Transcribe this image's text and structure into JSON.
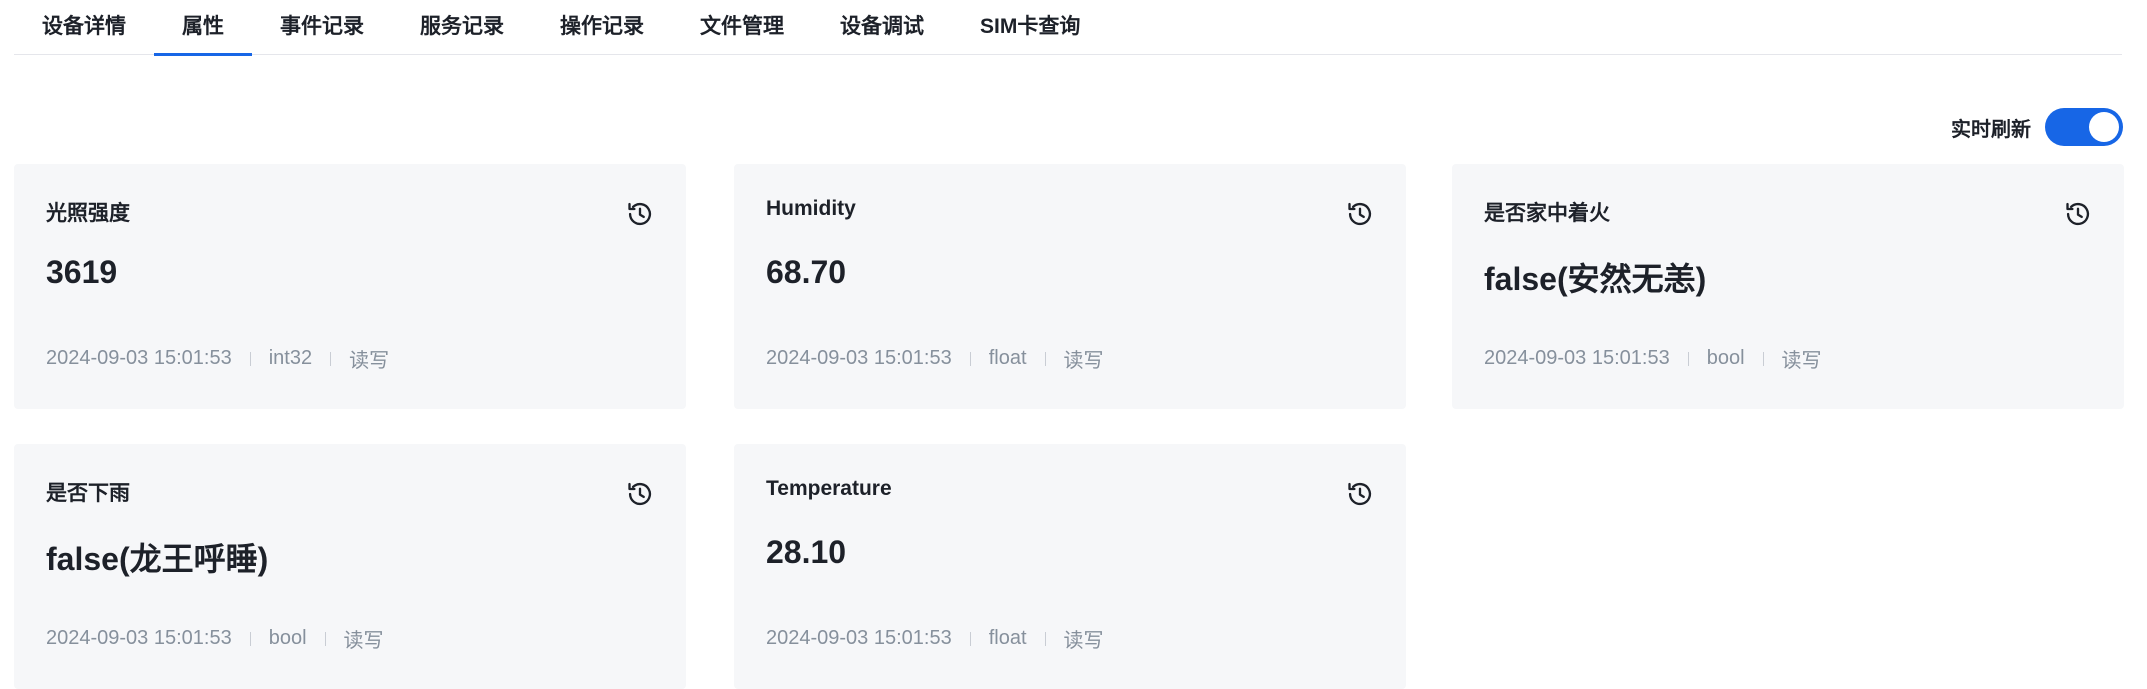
{
  "tabs": [
    {
      "label": "设备详情"
    },
    {
      "label": "属性"
    },
    {
      "label": "事件记录"
    },
    {
      "label": "服务记录"
    },
    {
      "label": "操作记录"
    },
    {
      "label": "文件管理"
    },
    {
      "label": "设备调试"
    },
    {
      "label": "SIM卡查询"
    }
  ],
  "active_tab": "属性",
  "realtime": {
    "label": "实时刷新",
    "enabled": true
  },
  "colors": {
    "accent": "#1766e6",
    "card_bg": "#f6f7f9",
    "meta": "#86909c"
  },
  "cards": [
    {
      "title": "光照强度",
      "value": "3619",
      "time": "2024-09-03 15:01:53",
      "type": "int32",
      "access": "读写",
      "icon": "history-icon"
    },
    {
      "title": "Humidity",
      "value": "68.70",
      "time": "2024-09-03 15:01:53",
      "type": "float",
      "access": "读写",
      "icon": "history-icon"
    },
    {
      "title": "是否家中着火",
      "value": "false(安然无恙)",
      "time": "2024-09-03 15:01:53",
      "type": "bool",
      "access": "读写",
      "icon": "history-icon"
    },
    {
      "title": "是否下雨",
      "value": "false(龙王呼睡)",
      "time": "2024-09-03 15:01:53",
      "type": "bool",
      "access": "读写",
      "icon": "history-icon"
    },
    {
      "title": "Temperature",
      "value": "28.10",
      "time": "2024-09-03 15:01:53",
      "type": "float",
      "access": "读写",
      "icon": "history-icon"
    }
  ]
}
